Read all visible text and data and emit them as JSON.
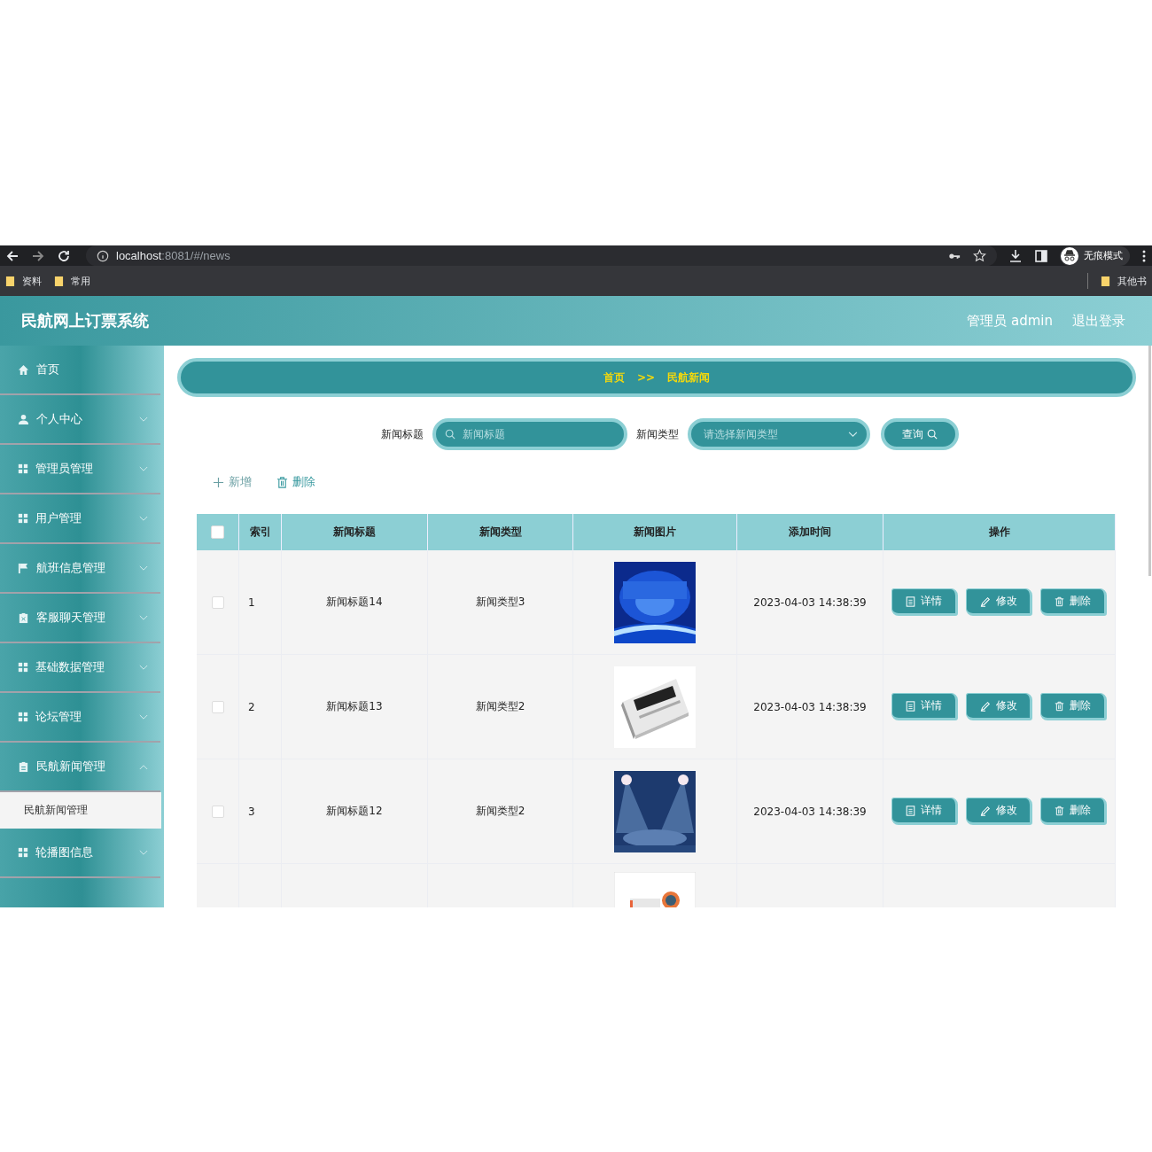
{
  "browser": {
    "url_host": "localhost",
    "url_rest": ":8081/#/news",
    "profile": "无痕模式",
    "bookmarks": [
      "资料",
      "常用"
    ],
    "other_bookmarks": "其他书"
  },
  "header": {
    "title": "民航网上订票系统",
    "user": "管理员 admin",
    "logout": "退出登录"
  },
  "sidebar": {
    "items": [
      {
        "label": "首页",
        "kind": "home",
        "has_children": false
      },
      {
        "label": "个人中心",
        "kind": "user",
        "has_children": true,
        "expanded": false
      },
      {
        "label": "管理员管理",
        "kind": "grid",
        "has_children": true,
        "expanded": false
      },
      {
        "label": "用户管理",
        "kind": "grid",
        "has_children": true,
        "expanded": false
      },
      {
        "label": "航班信息管理",
        "kind": "flag",
        "has_children": true,
        "expanded": false
      },
      {
        "label": "客服聊天管理",
        "kind": "chat",
        "has_children": true,
        "expanded": false
      },
      {
        "label": "基础数据管理",
        "kind": "grid",
        "has_children": true,
        "expanded": false
      },
      {
        "label": "论坛管理",
        "kind": "grid",
        "has_children": true,
        "expanded": false
      },
      {
        "label": "民航新闻管理",
        "kind": "news",
        "has_children": true,
        "expanded": true,
        "children": [
          {
            "label": "民航新闻管理",
            "selected": true
          }
        ]
      },
      {
        "label": "轮播图信息",
        "kind": "grid",
        "has_children": true,
        "expanded": false
      }
    ]
  },
  "breadcrumb": {
    "items": [
      "首页",
      "民航新闻"
    ],
    "separator": ">>"
  },
  "search": {
    "fields": [
      {
        "label": "新闻标题",
        "kind": "text",
        "placeholder": "新闻标题"
      },
      {
        "label": "新闻类型",
        "kind": "select",
        "placeholder": "请选择新闻类型"
      }
    ],
    "button": "查询"
  },
  "actions": [
    {
      "label": "新增",
      "kind": "add"
    },
    {
      "label": "删除",
      "kind": "delete"
    }
  ],
  "table": {
    "columns": [
      {
        "kind": "checkbox",
        "checked": false
      },
      {
        "kind": "text",
        "label": "索引"
      },
      {
        "kind": "text",
        "label": "新闻标题"
      },
      {
        "kind": "text",
        "label": "新闻类型"
      },
      {
        "kind": "text",
        "label": "新闻图片"
      },
      {
        "kind": "text",
        "label": "添加时间"
      },
      {
        "kind": "text",
        "label": "操作"
      }
    ],
    "rows": [
      {
        "checked": false,
        "index": "1",
        "title": "新闻标题14",
        "type": "新闻类型3",
        "time": "2023-04-03 14:38:39",
        "actions": [
          {
            "label": "详情",
            "kind": "detail"
          },
          {
            "label": "修改",
            "kind": "edit"
          },
          {
            "label": "删除",
            "kind": "delete"
          }
        ]
      },
      {
        "checked": false,
        "index": "2",
        "title": "新闻标题13",
        "type": "新闻类型2",
        "time": "2023-04-03 14:38:39",
        "actions": [
          {
            "label": "详情",
            "kind": "detail"
          },
          {
            "label": "修改",
            "kind": "edit"
          },
          {
            "label": "删除",
            "kind": "delete"
          }
        ]
      },
      {
        "checked": false,
        "index": "3",
        "title": "新闻标题12",
        "type": "新闻类型2",
        "time": "2023-04-03 14:38:39",
        "actions": [
          {
            "label": "详情",
            "kind": "detail"
          },
          {
            "label": "修改",
            "kind": "edit"
          },
          {
            "label": "删除",
            "kind": "delete"
          }
        ]
      }
    ]
  }
}
